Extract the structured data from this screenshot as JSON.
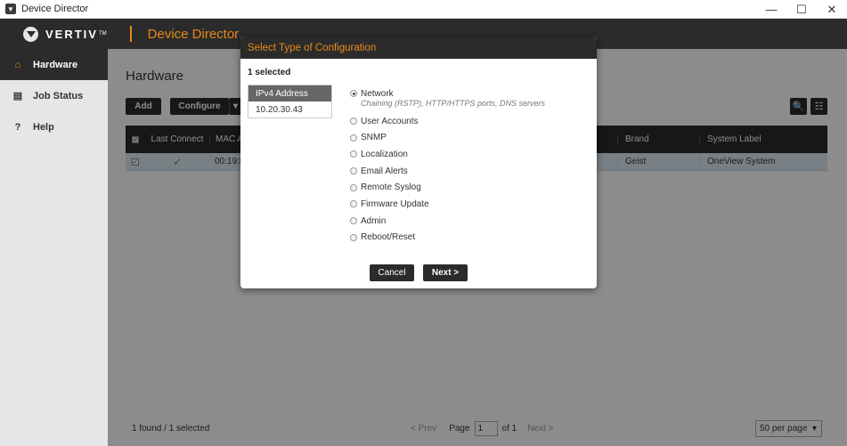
{
  "window": {
    "title": "Device Director",
    "min": "—",
    "max": "☐",
    "close": "✕"
  },
  "header": {
    "logo_text": "VERTIV",
    "logo_tm": "TM",
    "app_name": "Device Director"
  },
  "sidebar": {
    "items": [
      {
        "label": "Hardware",
        "icon": "home-icon",
        "glyph": "⌂",
        "active": true
      },
      {
        "label": "Job Status",
        "icon": "clipboard-icon",
        "glyph": "▤",
        "active": false
      },
      {
        "label": "Help",
        "icon": "help-icon",
        "glyph": "?",
        "active": false
      }
    ]
  },
  "main": {
    "title": "Hardware",
    "add_label": "Add",
    "configure_label": "Configure",
    "caret": "▾",
    "search_glyph": "🔍",
    "columns_glyph": "☷",
    "table": {
      "headers": {
        "last_connect": "Last Connect",
        "mac": "MAC A",
        "brand": "Brand",
        "system_label": "System Label"
      },
      "rows": [
        {
          "checked": "✓",
          "last_connect": "✓",
          "mac": "00:19:8",
          "brand": "Geist",
          "system_label": "OneView System"
        }
      ]
    },
    "footer": {
      "found": "1 found / 1 selected",
      "prev": "< Prev",
      "page_label": "Page",
      "page_value": "1",
      "of_label": "of 1",
      "next": "Next >",
      "per_page": "50 per page",
      "per_page_caret": "▾"
    }
  },
  "modal": {
    "title": "Select Type of Configuration",
    "selected_count": "1 selected",
    "ip_header": "IPv4 Address",
    "ip_rows": [
      "10.20.30.43"
    ],
    "options": [
      {
        "label": "Network",
        "selected": true,
        "desc": "Chaining (RSTP), HTTP/HTTPS ports, DNS servers"
      },
      {
        "label": "User Accounts",
        "selected": false
      },
      {
        "label": "SNMP",
        "selected": false
      },
      {
        "label": "Localization",
        "selected": false
      },
      {
        "label": "Email Alerts",
        "selected": false
      },
      {
        "label": "Remote Syslog",
        "selected": false
      },
      {
        "label": "Firmware Update",
        "selected": false
      },
      {
        "label": "Admin",
        "selected": false
      },
      {
        "label": "Reboot/Reset",
        "selected": false
      }
    ],
    "cancel_label": "Cancel",
    "next_label": "Next >"
  },
  "colors": {
    "accent": "#e8891c",
    "dark": "#2b2b2b",
    "row_selected": "#dbe9f4"
  }
}
